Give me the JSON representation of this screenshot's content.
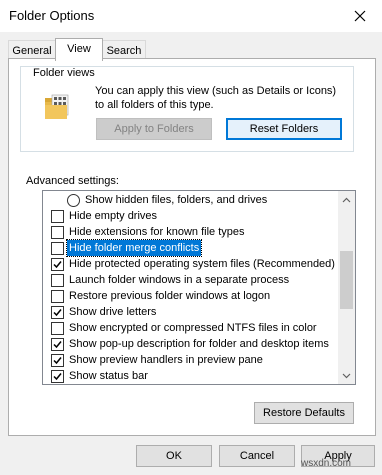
{
  "window": {
    "title": "Folder Options"
  },
  "tabs": [
    {
      "label": "General",
      "active": false
    },
    {
      "label": "View",
      "active": true
    },
    {
      "label": "Search",
      "active": false
    }
  ],
  "folder_views": {
    "group_label": "Folder views",
    "description": "You can apply this view (such as Details or Icons) to all folders of this type.",
    "apply_button": "Apply to Folders",
    "reset_button": "Reset Folders"
  },
  "advanced": {
    "label": "Advanced settings:",
    "items": [
      {
        "type": "radio",
        "label": "Show hidden files, folders, and drives",
        "checked": false,
        "selected": false
      },
      {
        "type": "checkbox",
        "label": "Hide empty drives",
        "checked": false,
        "selected": false
      },
      {
        "type": "checkbox",
        "label": "Hide extensions for known file types",
        "checked": false,
        "selected": false
      },
      {
        "type": "checkbox",
        "label": "Hide folder merge conflicts",
        "checked": false,
        "selected": true
      },
      {
        "type": "checkbox",
        "label": "Hide protected operating system files (Recommended)",
        "checked": true,
        "selected": false
      },
      {
        "type": "checkbox",
        "label": "Launch folder windows in a separate process",
        "checked": false,
        "selected": false
      },
      {
        "type": "checkbox",
        "label": "Restore previous folder windows at logon",
        "checked": false,
        "selected": false
      },
      {
        "type": "checkbox",
        "label": "Show drive letters",
        "checked": true,
        "selected": false
      },
      {
        "type": "checkbox",
        "label": "Show encrypted or compressed NTFS files in color",
        "checked": false,
        "selected": false
      },
      {
        "type": "checkbox",
        "label": "Show pop-up description for folder and desktop items",
        "checked": true,
        "selected": false
      },
      {
        "type": "checkbox",
        "label": "Show preview handlers in preview pane",
        "checked": true,
        "selected": false
      },
      {
        "type": "checkbox",
        "label": "Show status bar",
        "checked": true,
        "selected": false
      }
    ]
  },
  "buttons": {
    "restore_defaults": "Restore Defaults",
    "ok": "OK",
    "cancel": "Cancel",
    "apply": "Apply"
  },
  "watermark": "wsxdn.com"
}
